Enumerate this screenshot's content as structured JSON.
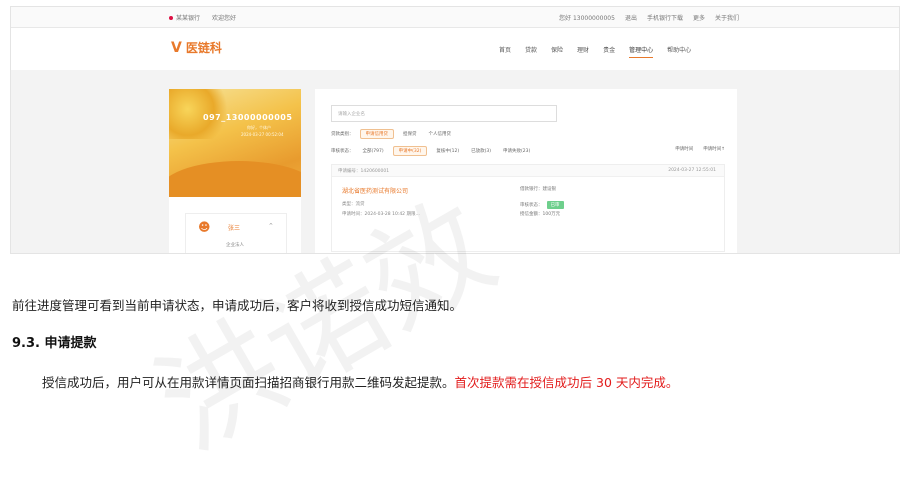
{
  "screenshot": {
    "topbar": {
      "left_items": [
        "某某银行",
        "欢迎您好"
      ],
      "right_items": [
        "您好 13000000005",
        "退出",
        "手机银行下载",
        "更多",
        "关于我们"
      ]
    },
    "brand": {
      "name": "医链科",
      "mark": "V"
    },
    "nav": [
      "首页",
      "贷款",
      "保险",
      "理财",
      "贵金",
      "管理中心",
      "帮助中心"
    ],
    "account_number": "097_13000000005",
    "account_sub1": "你好，个体户",
    "account_sub2": "2024-03-27 00:52:04",
    "user": {
      "name": "张三",
      "role": "企业法人"
    },
    "search_placeholder": "请输入企业名",
    "filter_types": {
      "label": "贷款类别：",
      "options": [
        "申请信用贷",
        "担保贷",
        "个人信用贷"
      ]
    },
    "filter_status": {
      "label": "审核状态：",
      "options": [
        "全部(797)",
        "申请中(32)",
        "复核中(12)",
        "已放款(3)",
        "申请失败(23)"
      ]
    },
    "sort": [
      "申请时间",
      "申请时间↑"
    ],
    "record": {
      "id_label": "申请编号：1420600001",
      "time": "2024-03-27 12:55:01",
      "company": "湖北省医药测试有限公司",
      "type": "类型：流贷",
      "apply_time": "申请时间：2024-03-28 10:42 期限...",
      "bank": "借款银行：建设银",
      "status_label": "审核状态：",
      "status": "已审",
      "limit": "授信金额：100万元"
    }
  },
  "document": {
    "para1": "前往进度管理可看到当前申请状态，申请成功后，客户将收到授信成功短信通知。",
    "heading": "9.3. 申请提款",
    "para2_normal": "授信成功后，用户可从在用款详情页面扫描招商银行用款二维码发起提款。",
    "para2_red": "首次提款需在授信成功后 30 天内完成。",
    "watermark": "洪诺效"
  },
  "colors": {
    "accent": "#e8792b",
    "warning_red": "#e21b1b",
    "badge_green": "#6ecf8c"
  }
}
